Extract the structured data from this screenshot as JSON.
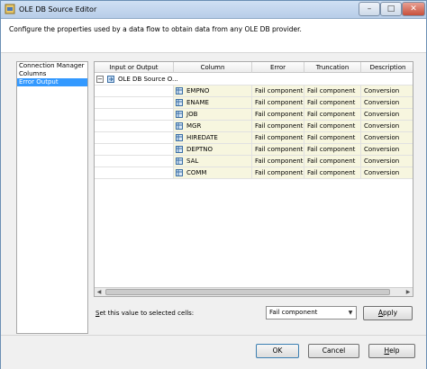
{
  "window": {
    "title": "OLE DB Source Editor",
    "minimize": "–",
    "maximize": "□",
    "close": "✕"
  },
  "header": {
    "description": "Configure the properties used by a data flow to obtain data from any OLE DB provider."
  },
  "nav": {
    "items": [
      {
        "label": "Connection Manager"
      },
      {
        "label": "Columns"
      },
      {
        "label": "Error Output"
      }
    ]
  },
  "grid": {
    "columns": [
      "Input or Output",
      "Column",
      "Error",
      "Truncation",
      "Description"
    ],
    "output_name": "OLE DB Source O...",
    "expander": "−",
    "rows": [
      {
        "column": "EMPNO",
        "error": "Fail component",
        "truncation": "Fail component",
        "description": "Conversion"
      },
      {
        "column": "ENAME",
        "error": "Fail component",
        "truncation": "Fail component",
        "description": "Conversion"
      },
      {
        "column": "JOB",
        "error": "Fail component",
        "truncation": "Fail component",
        "description": "Conversion"
      },
      {
        "column": "MGR",
        "error": "Fail component",
        "truncation": "Fail component",
        "description": "Conversion"
      },
      {
        "column": "HIREDATE",
        "error": "Fail component",
        "truncation": "Fail component",
        "description": "Conversion"
      },
      {
        "column": "DEPTNO",
        "error": "Fail component",
        "truncation": "Fail component",
        "description": "Conversion"
      },
      {
        "column": "SAL",
        "error": "Fail component",
        "truncation": "Fail component",
        "description": "Conversion"
      },
      {
        "column": "COMM",
        "error": "Fail component",
        "truncation": "Fail component",
        "description": "Conversion"
      }
    ]
  },
  "bottom": {
    "set_label": "Set this value to selected cells:",
    "set_value": "Fail component",
    "apply": "Apply"
  },
  "footer": {
    "ok": "OK",
    "cancel": "Cancel",
    "help": "Help"
  },
  "colors": {
    "selection": "#3399ff",
    "shaded_row": "#f7f6df"
  }
}
